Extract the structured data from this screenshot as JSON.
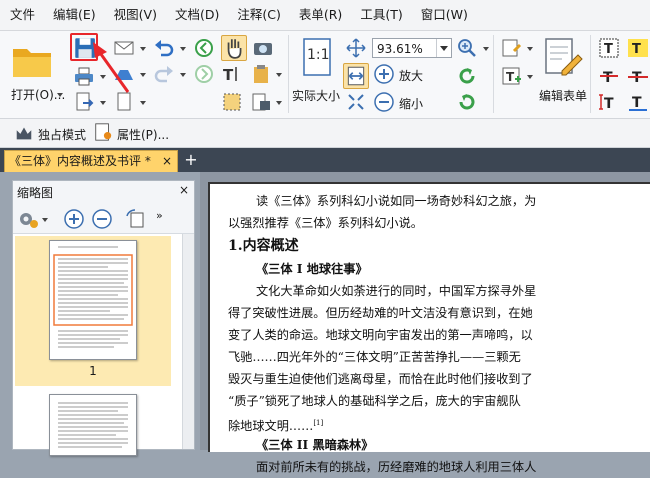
{
  "menu": [
    "文件",
    "编辑(E)",
    "视图(V)",
    "文档(D)",
    "注释(C)",
    "表单(R)",
    "工具(T)",
    "窗口(W)"
  ],
  "ribbon": {
    "open_label": "打开(O)...",
    "zoom_value": "93.61%",
    "zoom_in_label": "放大",
    "zoom_out_label": "缩小",
    "actual_size_label": "实际大小",
    "actual_size_icon_text": "1:1",
    "edit_form_label": "编辑表单"
  },
  "toolbar2": {
    "exclusive_mode_label": "独占模式",
    "properties_label": "属性(P)..."
  },
  "tab": {
    "title": "《三体》内容概述及书评 *",
    "close": "×",
    "new": "+"
  },
  "thumbnail_panel": {
    "title": "缩略图",
    "close": "×",
    "page_number": "1"
  },
  "document": {
    "intro_line1": "读《三体》系列科幻小说如同一场奇妙科幻之旅，为",
    "intro_line2": "以强烈推荐《三体》系列科幻小说。",
    "heading1": "1.内容概述",
    "sub1": "《三体 I  地球往事》",
    "body1": [
      "文化大革命如火如荼进行的同时，中国军方探寻外星",
      "得了突破性进展。但历经劫难的叶文洁没有意识到，在她",
      "变了人类的命运。地球文明向宇宙发出的第一声啼鸣，以",
      "飞驰……四光年外的“三体文明”正苦苦挣扎——三颗无",
      "毁灭与重生迫使他们逃离母星，而恰在此时他们接收到了",
      "“质子”锁死了地球人的基础科学之后，庞大的宇宙舰队",
      "除地球文明……"
    ],
    "footnote": "[1]",
    "sub2": "《三体 II  黑暗森林》",
    "body2_line1": "面对前所未有的挑战，历经磨难的地球人利用三体人"
  },
  "colors": {
    "highlight_box": "#e8262b",
    "tab_bg": "#ffd36b",
    "selected_thumb": "#fdeab2",
    "tab_bar": "#3c4653"
  }
}
